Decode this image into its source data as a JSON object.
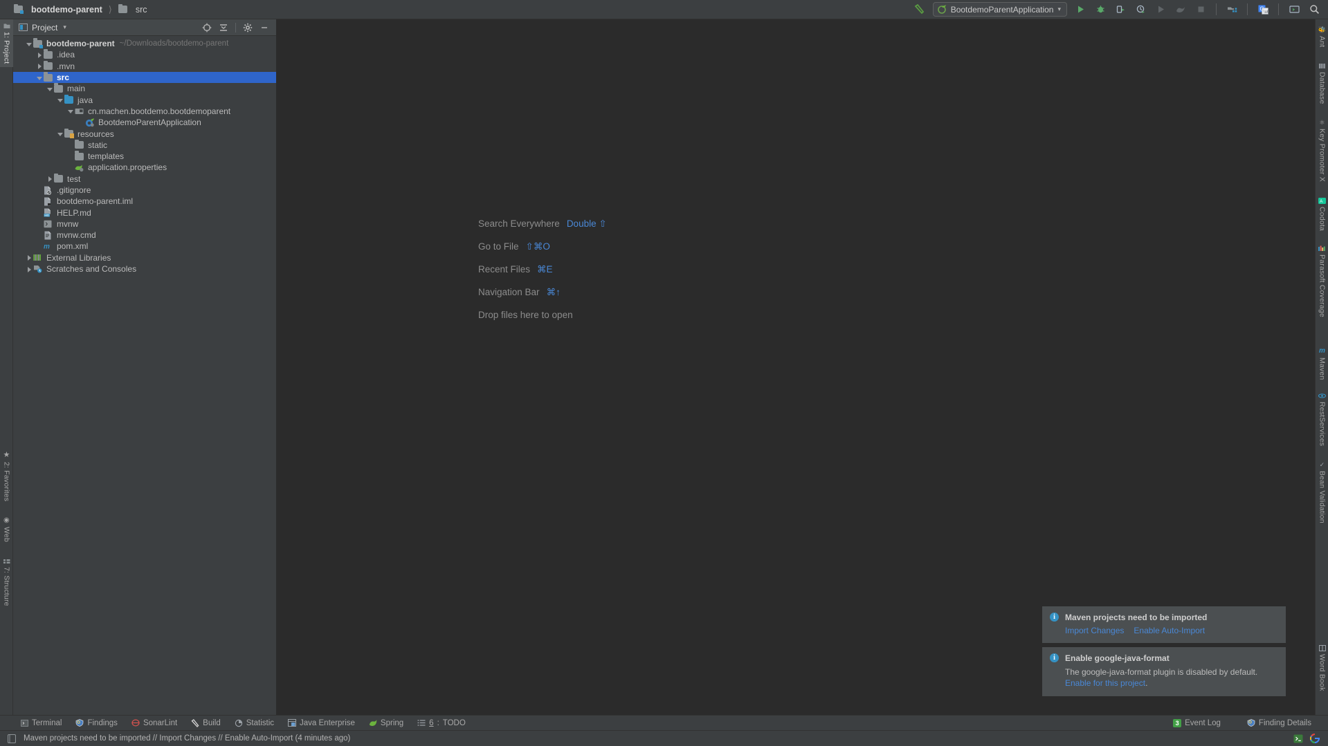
{
  "topbar": {
    "breadcrumb": [
      {
        "label": "bootdemo-parent",
        "icon": "module-folder-icon",
        "bold": true
      },
      {
        "label": "src",
        "icon": "folder-icon",
        "bold": false
      }
    ],
    "run_configuration": {
      "name": "BootdemoParentApplication",
      "icon": "spring-boot-icon",
      "dropdown": "▾"
    },
    "actions": [
      {
        "name": "build-hammer-icon",
        "label": "Build"
      },
      {
        "name": "run-icon",
        "label": "Run"
      },
      {
        "name": "debug-icon",
        "label": "Debug"
      },
      {
        "name": "run-with-coverage-icon",
        "label": "Run with Coverage"
      },
      {
        "name": "profile-icon",
        "label": "Profile"
      },
      {
        "name": "rerun-icon",
        "label": "Rerun"
      },
      {
        "name": "attach-debugger-icon",
        "label": "Attach"
      },
      {
        "name": "stop-icon",
        "label": "Stop"
      },
      {
        "name": "project-structure-icon",
        "label": "Project Structure"
      },
      {
        "name": "google-translate-icon",
        "label": "Translate"
      },
      {
        "name": "terminal-icon",
        "label": "Terminal"
      },
      {
        "name": "search-icon",
        "label": "Search Everywhere"
      }
    ]
  },
  "left_stripe": [
    {
      "label": "1: Project",
      "icon": "project-icon",
      "active": true
    },
    {
      "label": "2: Favorites",
      "icon": "star-icon",
      "active": false
    },
    {
      "label": "Web",
      "icon": "web-icon",
      "active": false
    },
    {
      "label": "7: Structure",
      "icon": "structure-icon",
      "active": false
    }
  ],
  "right_stripe": [
    {
      "label": "Ant",
      "icon": "ant-icon"
    },
    {
      "label": "Database",
      "icon": "database-icon"
    },
    {
      "label": "Key Promoter X",
      "icon": "key-promoter-icon"
    },
    {
      "label": "Codota",
      "icon": "codota-icon"
    },
    {
      "label": "Parasoft Coverage",
      "icon": "parasoft-coverage-icon"
    },
    {
      "label": "Maven",
      "icon": "maven-icon"
    },
    {
      "label": "RestServices",
      "icon": "rest-services-icon"
    },
    {
      "label": "Bean Validation",
      "icon": "bean-validation-icon"
    },
    {
      "label": "Word Book",
      "icon": "word-book-icon"
    }
  ],
  "project_panel": {
    "title": "Project",
    "title_icon": "project-view-icon",
    "dropdown": "▾",
    "header_actions": [
      {
        "name": "locate-target-icon",
        "label": "Select Opened File"
      },
      {
        "name": "collapse-all-icon",
        "label": "Collapse All"
      },
      {
        "name": "gear-icon",
        "label": "Settings"
      },
      {
        "name": "minimize-icon",
        "label": "Hide"
      }
    ],
    "tree": [
      {
        "label": "bootdemo-parent",
        "path": "~/Downloads/bootdemo-parent",
        "depth": 0,
        "arrow": "open",
        "icon": "module-folder-icon",
        "bold": true,
        "selected": false
      },
      {
        "label": ".idea",
        "path": "",
        "depth": 1,
        "arrow": "closed",
        "icon": "folder-icon",
        "bold": false,
        "selected": false
      },
      {
        "label": ".mvn",
        "path": "",
        "depth": 1,
        "arrow": "closed",
        "icon": "folder-icon",
        "bold": false,
        "selected": false
      },
      {
        "label": "src",
        "path": "",
        "depth": 1,
        "arrow": "open",
        "icon": "folder-icon",
        "bold": true,
        "selected": true
      },
      {
        "label": "main",
        "path": "",
        "depth": 2,
        "arrow": "open",
        "icon": "folder-icon",
        "bold": false,
        "selected": false
      },
      {
        "label": "java",
        "path": "",
        "depth": 3,
        "arrow": "open",
        "icon": "source-folder-icon",
        "bold": false,
        "selected": false
      },
      {
        "label": "cn.machen.bootdemo.bootdemoparent",
        "path": "",
        "depth": 4,
        "arrow": "open",
        "icon": "package-icon",
        "bold": false,
        "selected": false
      },
      {
        "label": "BootdemoParentApplication",
        "path": "",
        "depth": 5,
        "arrow": "none",
        "icon": "spring-boot-class-icon",
        "bold": false,
        "selected": false
      },
      {
        "label": "resources",
        "path": "",
        "depth": 3,
        "arrow": "open",
        "icon": "resources-folder-icon",
        "bold": false,
        "selected": false
      },
      {
        "label": "static",
        "path": "",
        "depth": 4,
        "arrow": "none",
        "icon": "folder-icon",
        "bold": false,
        "selected": false
      },
      {
        "label": "templates",
        "path": "",
        "depth": 4,
        "arrow": "none",
        "icon": "folder-icon",
        "bold": false,
        "selected": false
      },
      {
        "label": "application.properties",
        "path": "",
        "depth": 4,
        "arrow": "none",
        "icon": "spring-properties-icon",
        "bold": false,
        "selected": false
      },
      {
        "label": "test",
        "path": "",
        "depth": 2,
        "arrow": "closed",
        "icon": "folder-icon",
        "bold": false,
        "selected": false
      },
      {
        "label": ".gitignore",
        "path": "",
        "depth": 1,
        "arrow": "none",
        "icon": "gitignore-file-icon",
        "bold": false,
        "selected": false
      },
      {
        "label": "bootdemo-parent.iml",
        "path": "",
        "depth": 1,
        "arrow": "none",
        "icon": "iml-file-icon",
        "bold": false,
        "selected": false
      },
      {
        "label": "HELP.md",
        "path": "",
        "depth": 1,
        "arrow": "none",
        "icon": "markdown-file-icon",
        "bold": false,
        "selected": false
      },
      {
        "label": "mvnw",
        "path": "",
        "depth": 1,
        "arrow": "none",
        "icon": "shell-script-icon",
        "bold": false,
        "selected": false
      },
      {
        "label": "mvnw.cmd",
        "path": "",
        "depth": 1,
        "arrow": "none",
        "icon": "cmd-script-icon",
        "bold": false,
        "selected": false
      },
      {
        "label": "pom.xml",
        "path": "",
        "depth": 1,
        "arrow": "none",
        "icon": "maven-pom-icon",
        "bold": false,
        "selected": false
      },
      {
        "label": "External Libraries",
        "path": "",
        "depth": 0,
        "arrow": "closed",
        "icon": "libraries-icon",
        "bold": false,
        "selected": false
      },
      {
        "label": "Scratches and Consoles",
        "path": "",
        "depth": 0,
        "arrow": "closed",
        "icon": "scratches-icon",
        "bold": false,
        "selected": false
      }
    ]
  },
  "editor": {
    "hints": [
      {
        "action": "Search Everywhere",
        "shortcut": "Double ⇧"
      },
      {
        "action": "Go to File",
        "shortcut": "⇧⌘O"
      },
      {
        "action": "Recent Files",
        "shortcut": "⌘E"
      },
      {
        "action": "Navigation Bar",
        "shortcut": "⌘↑"
      },
      {
        "action": "Drop files here to open",
        "shortcut": ""
      }
    ]
  },
  "notifications": [
    {
      "icon": "info-icon",
      "title": "Maven projects need to be imported",
      "text": "",
      "links": [
        "Import Changes",
        "Enable Auto-Import"
      ]
    },
    {
      "icon": "info-icon",
      "title": "Enable google-java-format",
      "text_before": "The google-java-format plugin is disabled by default. ",
      "link": "Enable for this project",
      "text_after": ".",
      "links": []
    }
  ],
  "tool_window_bar": {
    "items": [
      {
        "label": "Terminal",
        "icon": "terminal-icon",
        "num": ""
      },
      {
        "label": "Findings",
        "icon": "findings-icon",
        "num": ""
      },
      {
        "label": "SonarLint",
        "icon": "sonarlint-icon",
        "num": ""
      },
      {
        "label": "Build",
        "icon": "build-hammer-icon",
        "num": ""
      },
      {
        "label": "Statistic",
        "icon": "statistic-icon",
        "num": ""
      },
      {
        "label": "Java Enterprise",
        "icon": "java-enterprise-icon",
        "num": ""
      },
      {
        "label": "Spring",
        "icon": "spring-icon",
        "num": ""
      },
      {
        "label": "TODO",
        "icon": "todo-icon",
        "num": "6"
      }
    ],
    "right": [
      {
        "label": "Event Log",
        "icon": "event-log-icon",
        "count": "3"
      },
      {
        "label": "Finding Details",
        "icon": "finding-details-icon",
        "count": ""
      }
    ]
  },
  "status_bar": {
    "icon": "status-message-icon",
    "message": "Maven projects need to be imported // Import Changes // Enable Auto-Import (4 minutes ago)",
    "right_icons": [
      {
        "name": "terminal-widget-icon"
      },
      {
        "name": "google-widget-icon"
      }
    ]
  },
  "colors": {
    "selection_blue": "#2f65ca",
    "link_blue": "#4a88d6",
    "accent_green": "#43a047",
    "panel_bg": "#3c3f41",
    "editor_bg": "#2b2b2b",
    "notification_bg": "#4b4f51"
  }
}
